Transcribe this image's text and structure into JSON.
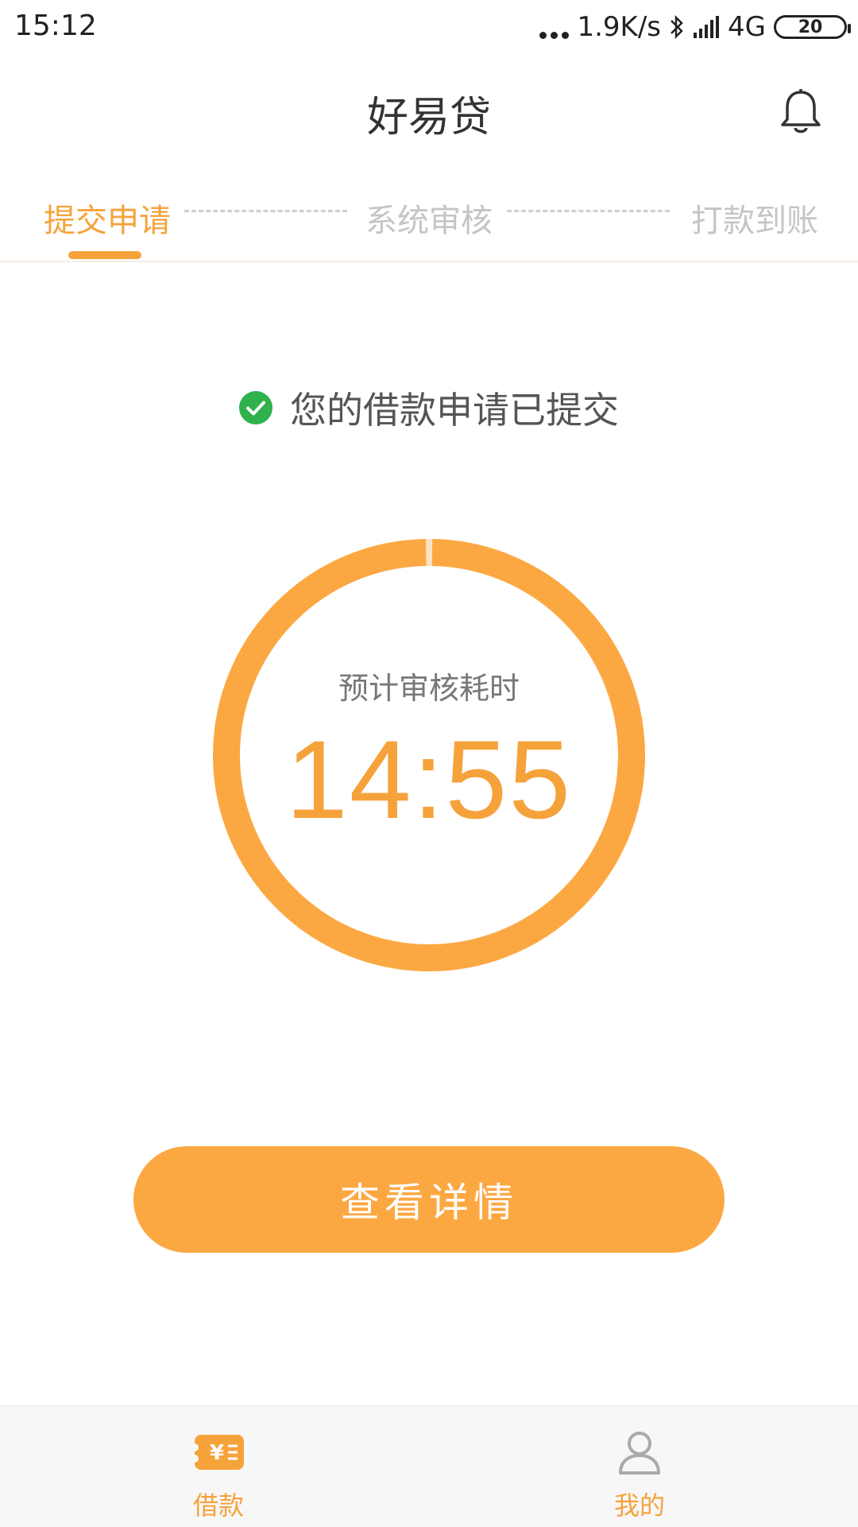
{
  "status_bar": {
    "time": "15:12",
    "net_speed": "1.9K/s",
    "network": "4G",
    "battery": "20"
  },
  "header": {
    "title": "好易贷"
  },
  "steps": [
    {
      "label": "提交申请",
      "active": true
    },
    {
      "label": "系统审核",
      "active": false
    },
    {
      "label": "打款到账",
      "active": false
    }
  ],
  "notice": {
    "text": "您的借款申请已提交"
  },
  "timer": {
    "label": "预计审核耗时",
    "value": "14:55",
    "elapsed_fraction": 0.995
  },
  "actions": {
    "details_label": "查看详情"
  },
  "bottom_nav": [
    {
      "label": "借款",
      "active": true,
      "icon": "loan-icon"
    },
    {
      "label": "我的",
      "active": true,
      "icon": "person-icon"
    }
  ],
  "colors": {
    "accent": "#f6a23b",
    "button": "#fca842",
    "success": "#2fb14b"
  }
}
